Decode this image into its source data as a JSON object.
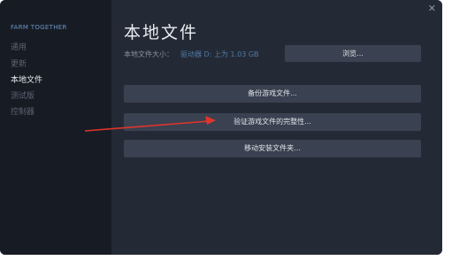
{
  "sidebar": {
    "game_title": "FARM TOGETHER",
    "items": [
      {
        "label": "通用",
        "active": false
      },
      {
        "label": "更新",
        "active": false
      },
      {
        "label": "本地文件",
        "active": true
      },
      {
        "label": "测试版",
        "active": false
      },
      {
        "label": "控制器",
        "active": false
      }
    ]
  },
  "main": {
    "title": "本地文件",
    "size_label": "本地文件大小：",
    "size_value": "驱动器 D: 上为 1.03 GB",
    "browse_label": "浏览...",
    "backup_label": "备份游戏文件...",
    "verify_label": "验证游戏文件的完整性...",
    "move_label": "移动安装文件夹..."
  },
  "window": {
    "close_icon": "close-icon"
  },
  "annotation": {
    "arrow_color": "#e0352b"
  },
  "colors": {
    "background": "#1c212b",
    "sidebar": "#171b23",
    "panel": "#242a35",
    "button": "#3a4150",
    "accent": "#4f79a6"
  }
}
